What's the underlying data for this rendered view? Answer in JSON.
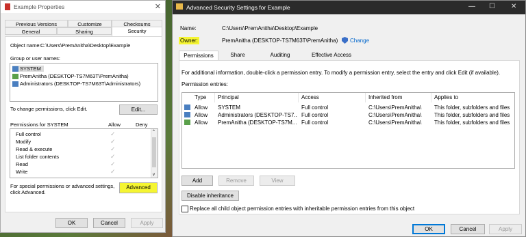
{
  "left": {
    "title": "Example Properties",
    "tabs_row1": [
      "Previous Versions",
      "Customize",
      "Checksums"
    ],
    "tabs_row2": [
      "General",
      "Sharing",
      "Security"
    ],
    "object_name_label": "Object name:",
    "object_name_value": "C:\\Users\\PremAnitha\\Desktop\\Example",
    "group_label": "Group or user names:",
    "users": [
      "SYSTEM",
      "PremAnitha (DESKTOP-TS7M63T\\PremAnitha)",
      "Administrators (DESKTOP-TS7M63T\\Administrators)"
    ],
    "change_text": "To change permissions, click Edit.",
    "edit_label": "Edit...",
    "perm_for": "Permissions for SYSTEM",
    "allow": "Allow",
    "deny": "Deny",
    "perms": [
      "Full control",
      "Modify",
      "Read & execute",
      "List folder contents",
      "Read",
      "Write"
    ],
    "check_glyph": "✓",
    "special_text_1": "For special permissions or advanced settings,",
    "special_text_2": "click Advanced.",
    "advanced_label": "Advanced",
    "ok": "OK",
    "cancel": "Cancel",
    "apply": "Apply",
    "close": "✕"
  },
  "right": {
    "title": "Advanced Security Settings for Example",
    "minimize": "—",
    "maximize": "☐",
    "close": "✕",
    "name_label": "Name:",
    "name_value": "C:\\Users\\PremAnitha\\Desktop\\Example",
    "owner_label": "Owner:",
    "owner_value": "PremAnitha (DESKTOP-TS7M63T\\PremAnitha)",
    "change_label": "Change",
    "tabs": [
      "Permissions",
      "Share",
      "Auditing",
      "Effective Access"
    ],
    "info_text": "For additional information, double-click a permission entry. To modify a permission entry, select the entry and click Edit (if available).",
    "entries_label": "Permission entries:",
    "columns": [
      "Type",
      "Principal",
      "Access",
      "Inherited from",
      "Applies to"
    ],
    "rows": [
      [
        "Allow",
        "SYSTEM",
        "Full control",
        "C:\\Users\\PremAnitha\\",
        "This folder, subfolders and files"
      ],
      [
        "Allow",
        "Administrators (DESKTOP-TS7...",
        "Full control",
        "C:\\Users\\PremAnitha\\",
        "This folder, subfolders and files"
      ],
      [
        "Allow",
        "PremAnitha (DESKTOP-TS7M...",
        "Full control",
        "C:\\Users\\PremAnitha\\",
        "This folder, subfolders and files"
      ]
    ],
    "add": "Add",
    "remove": "Remove",
    "view": "View",
    "disable_inheritance": "Disable inheritance",
    "replace_text": "Replace all child object permission entries with inheritable permission entries from this object",
    "ok": "OK",
    "cancel": "Cancel",
    "apply": "Apply"
  },
  "colors": {
    "highlight": "#f5f532",
    "accent": "#0078d7"
  }
}
